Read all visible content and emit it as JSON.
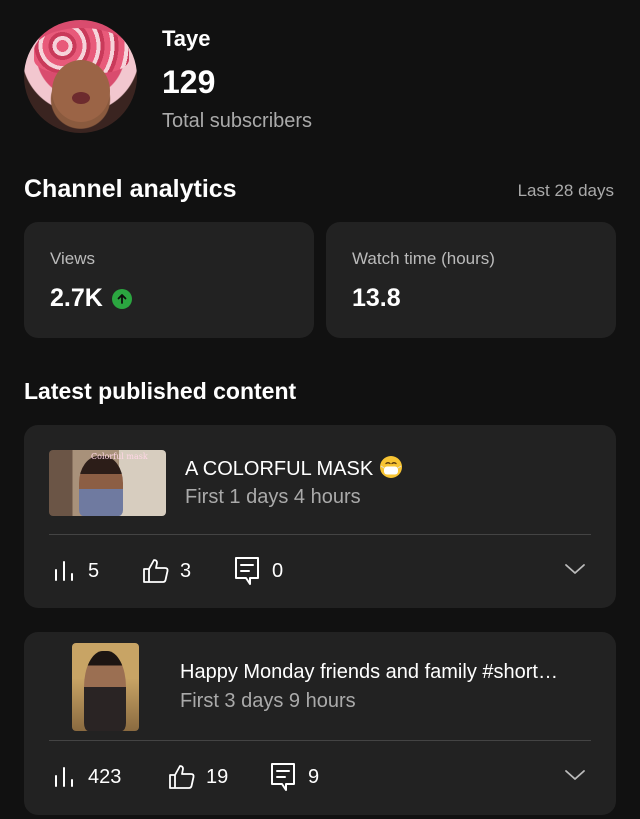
{
  "channel": {
    "name": "Taye",
    "subscriber_count": "129",
    "subscriber_label": "Total subscribers"
  },
  "analytics": {
    "title": "Channel analytics",
    "range": "Last 28 days",
    "metrics": [
      {
        "label": "Views",
        "value": "2.7K",
        "trend": "up",
        "trend_color": "#2ba640"
      },
      {
        "label": "Watch time (hours)",
        "value": "13.8"
      }
    ]
  },
  "latest": {
    "title": "Latest published content",
    "items": [
      {
        "title": "A COLORFUL MASK",
        "emoji_icon": "mask-face-emoji-icon",
        "thumbnail_text": "Colorful mask",
        "subtitle": "First 1 days 4 hours",
        "views": "5",
        "likes": "3",
        "comments": "0"
      },
      {
        "title": "Happy Monday friends and family #short…",
        "subtitle": "First 3 days 9 hours",
        "views": "423",
        "likes": "19",
        "comments": "9"
      }
    ]
  },
  "colors": {
    "background": "#111111",
    "card": "#222222",
    "secondary_text": "#aaaaaa",
    "trend_up": "#2ba640"
  }
}
